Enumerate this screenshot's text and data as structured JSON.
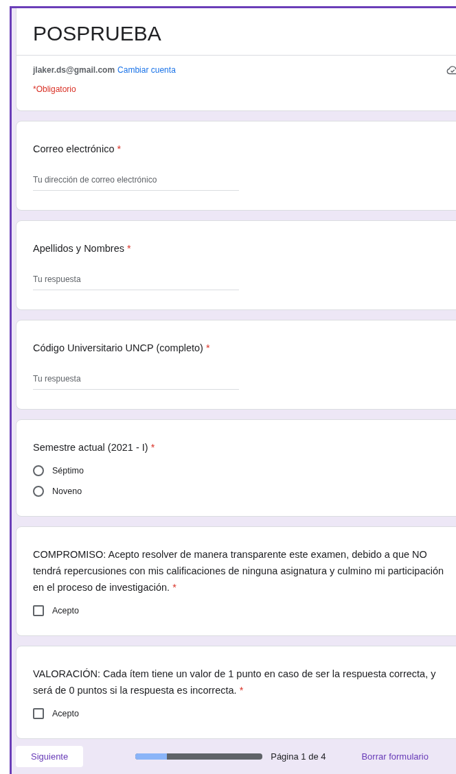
{
  "form": {
    "title": "POSPRUEBA",
    "account": "jlaker.ds@gmail.com",
    "switch_account": "Cambiar cuenta",
    "required_note": "*Obligatorio"
  },
  "questions": [
    {
      "kind": "text",
      "title": "Correo electrónico",
      "required_mark": "*",
      "placeholder": "Tu dirección de correo electrónico"
    },
    {
      "kind": "text",
      "title": "Apellidos y Nombres",
      "required_mark": "*",
      "placeholder": "Tu respuesta"
    },
    {
      "kind": "text",
      "title": "Código Universitario UNCP (completo)",
      "required_mark": "*",
      "placeholder": "Tu respuesta"
    },
    {
      "kind": "radio",
      "title": "Semestre actual (2021 - I)",
      "required_mark": "*",
      "options": [
        {
          "label": "Séptimo",
          "selected": false
        },
        {
          "label": "Noveno",
          "selected": false
        }
      ]
    },
    {
      "kind": "checkbox",
      "title": "COMPROMISO: Acepto resolver de manera transparente este examen, debido a que NO tendrá repercusiones con mis calificaciones de ninguna asignatura y culmino mi participación en el proceso de investigación.",
      "required_mark": "*",
      "options": [
        {
          "label": "Acepto",
          "checked": false
        }
      ]
    },
    {
      "kind": "checkbox",
      "title": "VALORACIÓN: Cada ítem tiene un valor de 1 punto en caso de ser la respuesta correcta, y será de 0 puntos si la respuesta es incorrecta.",
      "required_mark": "*",
      "options": [
        {
          "label": "Acepto",
          "checked": false
        }
      ]
    }
  ],
  "footer": {
    "next_button": "Siguiente",
    "progress": {
      "level": 0.25
    },
    "page_label": "Página 1 de 4",
    "clear_link": "Borrar formulario"
  }
}
